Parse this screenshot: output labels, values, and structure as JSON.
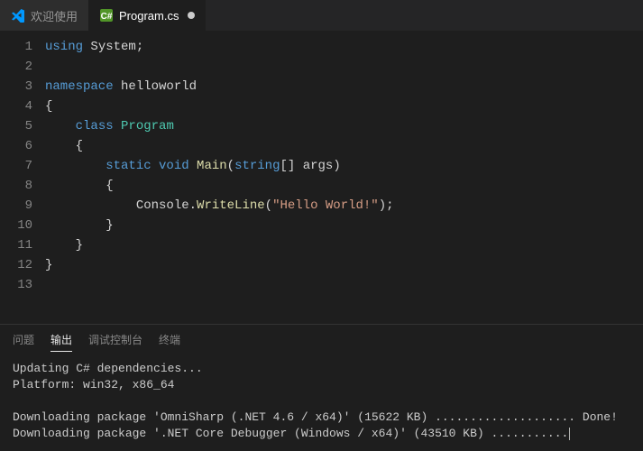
{
  "tabs": [
    {
      "label": "欢迎使用",
      "icon": "vscode",
      "active": false
    },
    {
      "label": "Program.cs",
      "icon": "csharp",
      "active": true,
      "dirty": true
    }
  ],
  "code": {
    "lines": [
      {
        "n": "1",
        "tokens": [
          [
            "keyword",
            "using "
          ],
          [
            "ident",
            "System"
          ],
          [
            "punct",
            ";"
          ]
        ]
      },
      {
        "n": "2",
        "tokens": []
      },
      {
        "n": "3",
        "tokens": [
          [
            "keyword",
            "namespace "
          ],
          [
            "ident",
            "helloworld"
          ]
        ]
      },
      {
        "n": "4",
        "tokens": [
          [
            "punct",
            "{"
          ]
        ]
      },
      {
        "n": "5",
        "tokens": [
          [
            "indent",
            "    "
          ],
          [
            "keyword",
            "class "
          ],
          [
            "class",
            "Program"
          ]
        ]
      },
      {
        "n": "6",
        "tokens": [
          [
            "indent",
            "    "
          ],
          [
            "punct",
            "{"
          ]
        ]
      },
      {
        "n": "7",
        "tokens": [
          [
            "indent",
            "        "
          ],
          [
            "keyword",
            "static "
          ],
          [
            "type",
            "void "
          ],
          [
            "method",
            "Main"
          ],
          [
            "punct",
            "("
          ],
          [
            "type",
            "string"
          ],
          [
            "punct",
            "[] "
          ],
          [
            "ident",
            "args"
          ],
          [
            "punct",
            ")"
          ]
        ]
      },
      {
        "n": "8",
        "tokens": [
          [
            "indent",
            "        "
          ],
          [
            "punct",
            "{"
          ]
        ]
      },
      {
        "n": "9",
        "tokens": [
          [
            "indent",
            "            "
          ],
          [
            "ident",
            "Console"
          ],
          [
            "punct",
            "."
          ],
          [
            "method",
            "WriteLine"
          ],
          [
            "punct",
            "("
          ],
          [
            "string",
            "\"Hello World!\""
          ],
          [
            "punct",
            ");"
          ]
        ]
      },
      {
        "n": "10",
        "tokens": [
          [
            "indent",
            "        "
          ],
          [
            "punct",
            "}"
          ]
        ]
      },
      {
        "n": "11",
        "tokens": [
          [
            "indent",
            "    "
          ],
          [
            "punct",
            "}"
          ]
        ]
      },
      {
        "n": "12",
        "tokens": [
          [
            "punct",
            "}"
          ]
        ]
      },
      {
        "n": "13",
        "tokens": []
      }
    ]
  },
  "panel": {
    "tabs": [
      {
        "label": "问题",
        "active": false
      },
      {
        "label": "输出",
        "active": true
      },
      {
        "label": "调试控制台",
        "active": false
      },
      {
        "label": "终端",
        "active": false
      }
    ],
    "output_lines": [
      "Updating C# dependencies...",
      "Platform: win32, x86_64",
      "",
      "Downloading package 'OmniSharp (.NET 4.6 / x64)' (15622 KB) .................... Done!",
      "Downloading package '.NET Core Debugger (Windows / x64)' (43510 KB) ..........."
    ]
  },
  "icons": {
    "vscode_color": "#0098ff",
    "csharp_color": "#68217a"
  }
}
